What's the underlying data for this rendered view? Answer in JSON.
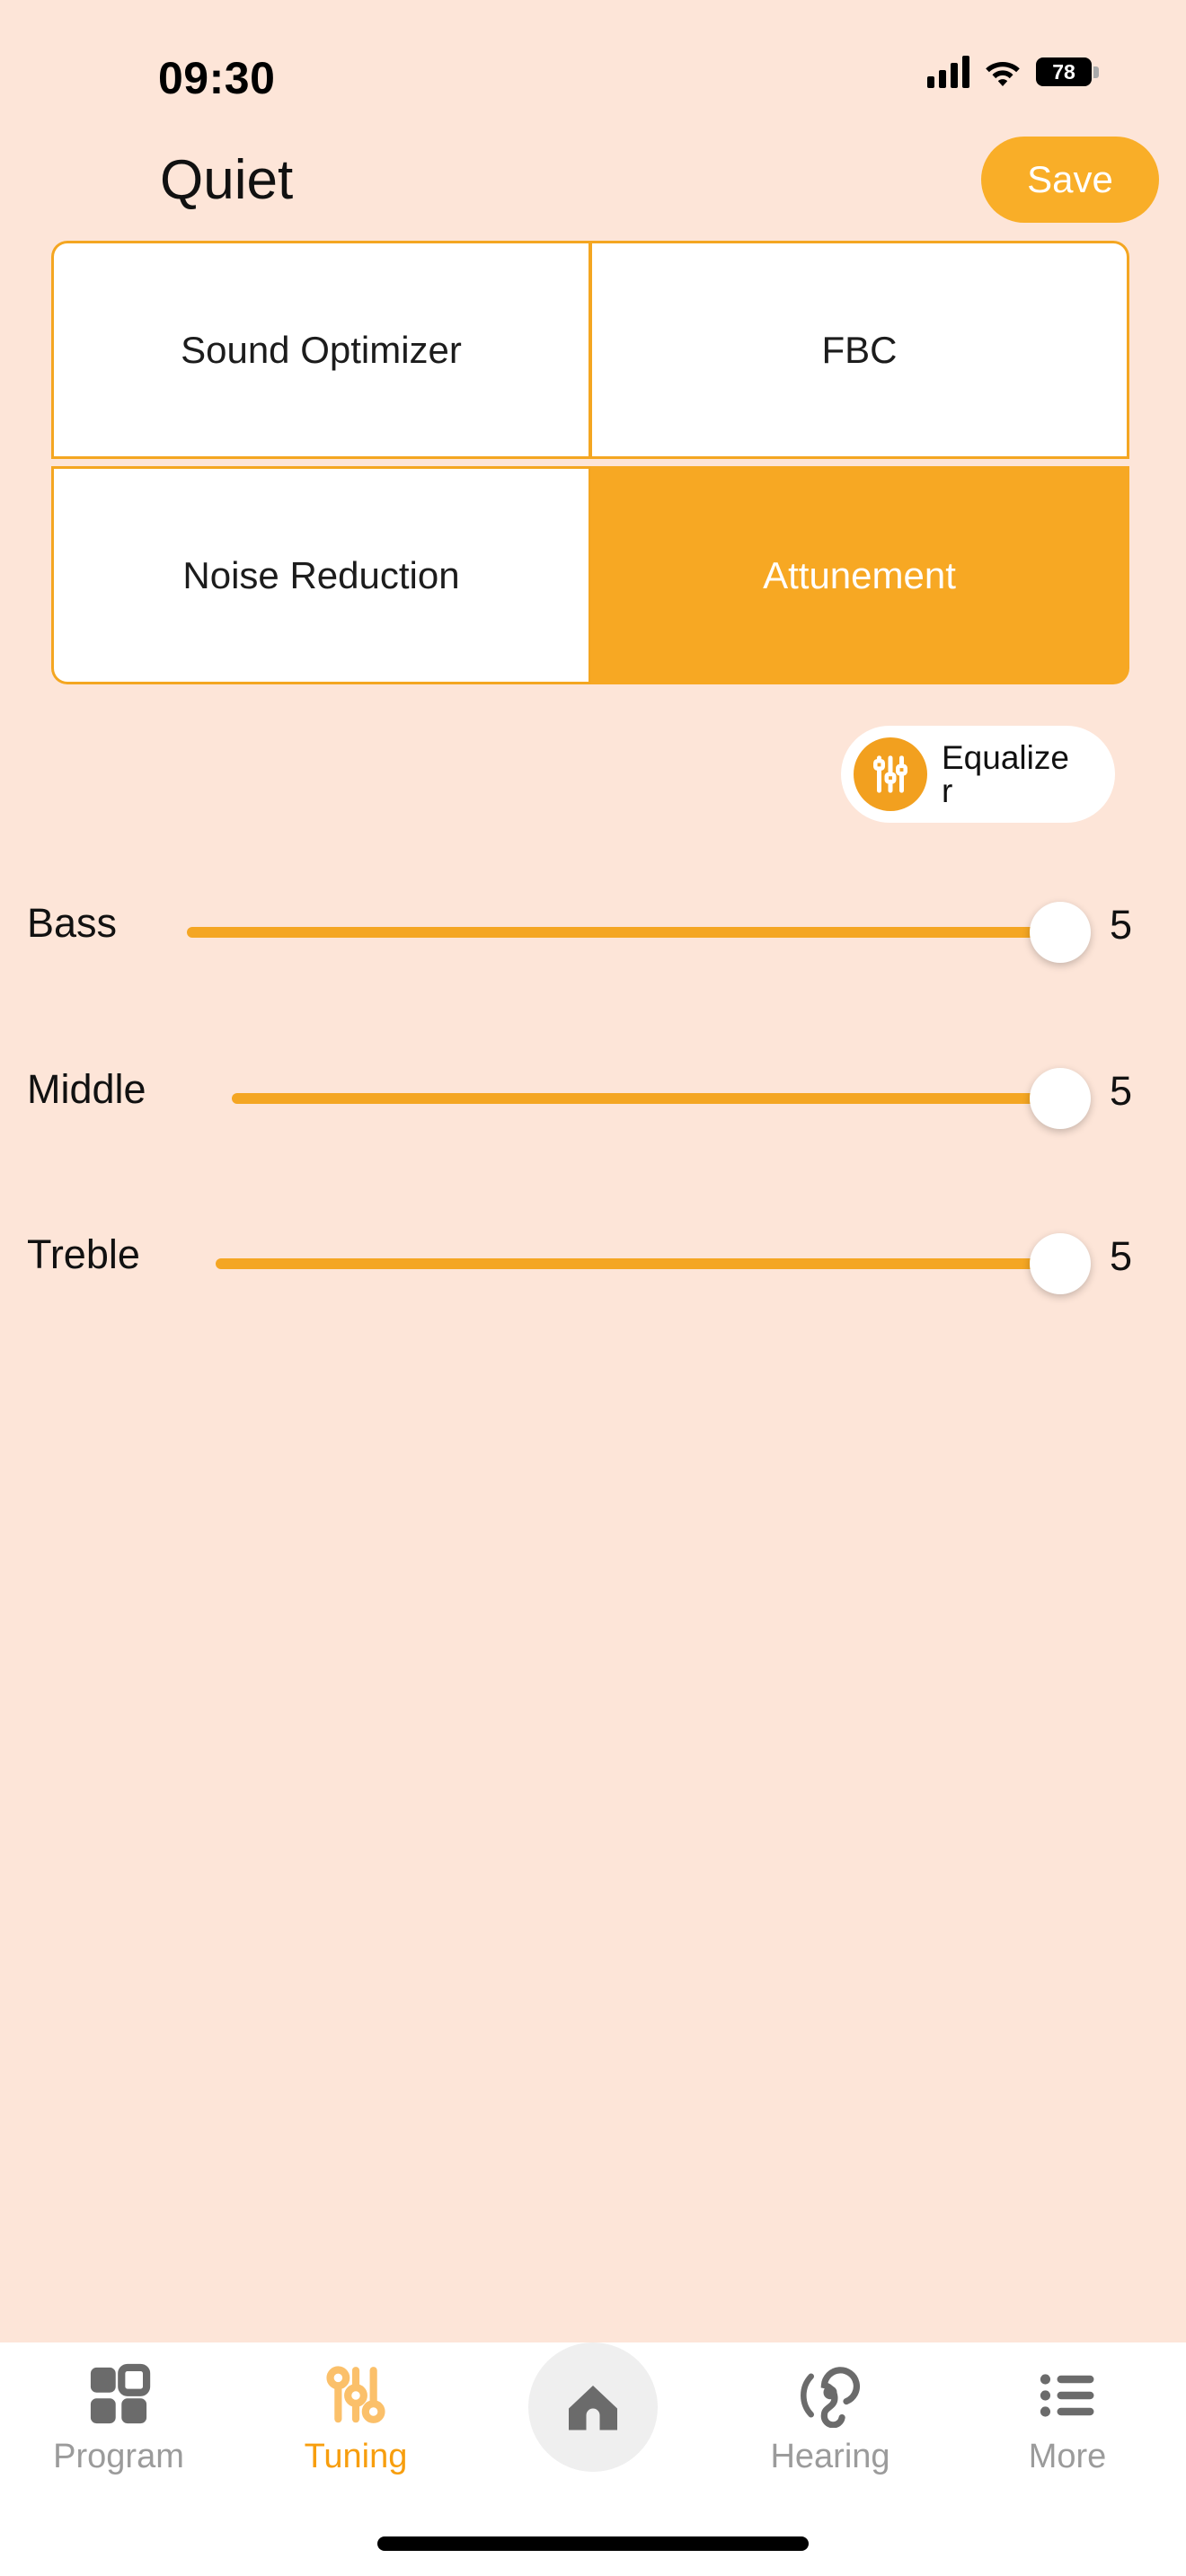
{
  "status_bar": {
    "time": "09:30",
    "battery_percent": "78",
    "signal_icon": "cellular-signal-icon",
    "wifi_icon": "wifi-icon",
    "battery_icon": "battery-icon"
  },
  "header": {
    "title": "Quiet",
    "save_label": "Save"
  },
  "feature_grid": {
    "cells": [
      {
        "label": "Sound Optimizer",
        "active": false
      },
      {
        "label": "FBC",
        "active": false
      },
      {
        "label": "Noise Reduction",
        "active": false
      },
      {
        "label": "Attunement",
        "active": true
      }
    ]
  },
  "equalizer": {
    "label": "Equalizer",
    "icon": "equalizer-sliders-icon"
  },
  "sliders": [
    {
      "label": "Bass",
      "value": "5"
    },
    {
      "label": "Middle",
      "value": "5"
    },
    {
      "label": "Treble",
      "value": "5"
    }
  ],
  "tab_bar": {
    "tabs": [
      {
        "label": "Program",
        "icon": "grid-squares-icon",
        "active": false
      },
      {
        "label": "Tuning",
        "icon": "tuning-sliders-icon",
        "active": true
      },
      {
        "label": "",
        "icon": "home-icon",
        "active": false
      },
      {
        "label": "Hearing",
        "icon": "ear-icon",
        "active": false
      },
      {
        "label": "More",
        "icon": "list-icon",
        "active": false
      }
    ]
  },
  "colors": {
    "background": "#fde5d8",
    "accent": "#f4a623",
    "accent_dark": "#f79e0e",
    "surface": "#ffffff",
    "muted_text": "#9b9b9b"
  }
}
